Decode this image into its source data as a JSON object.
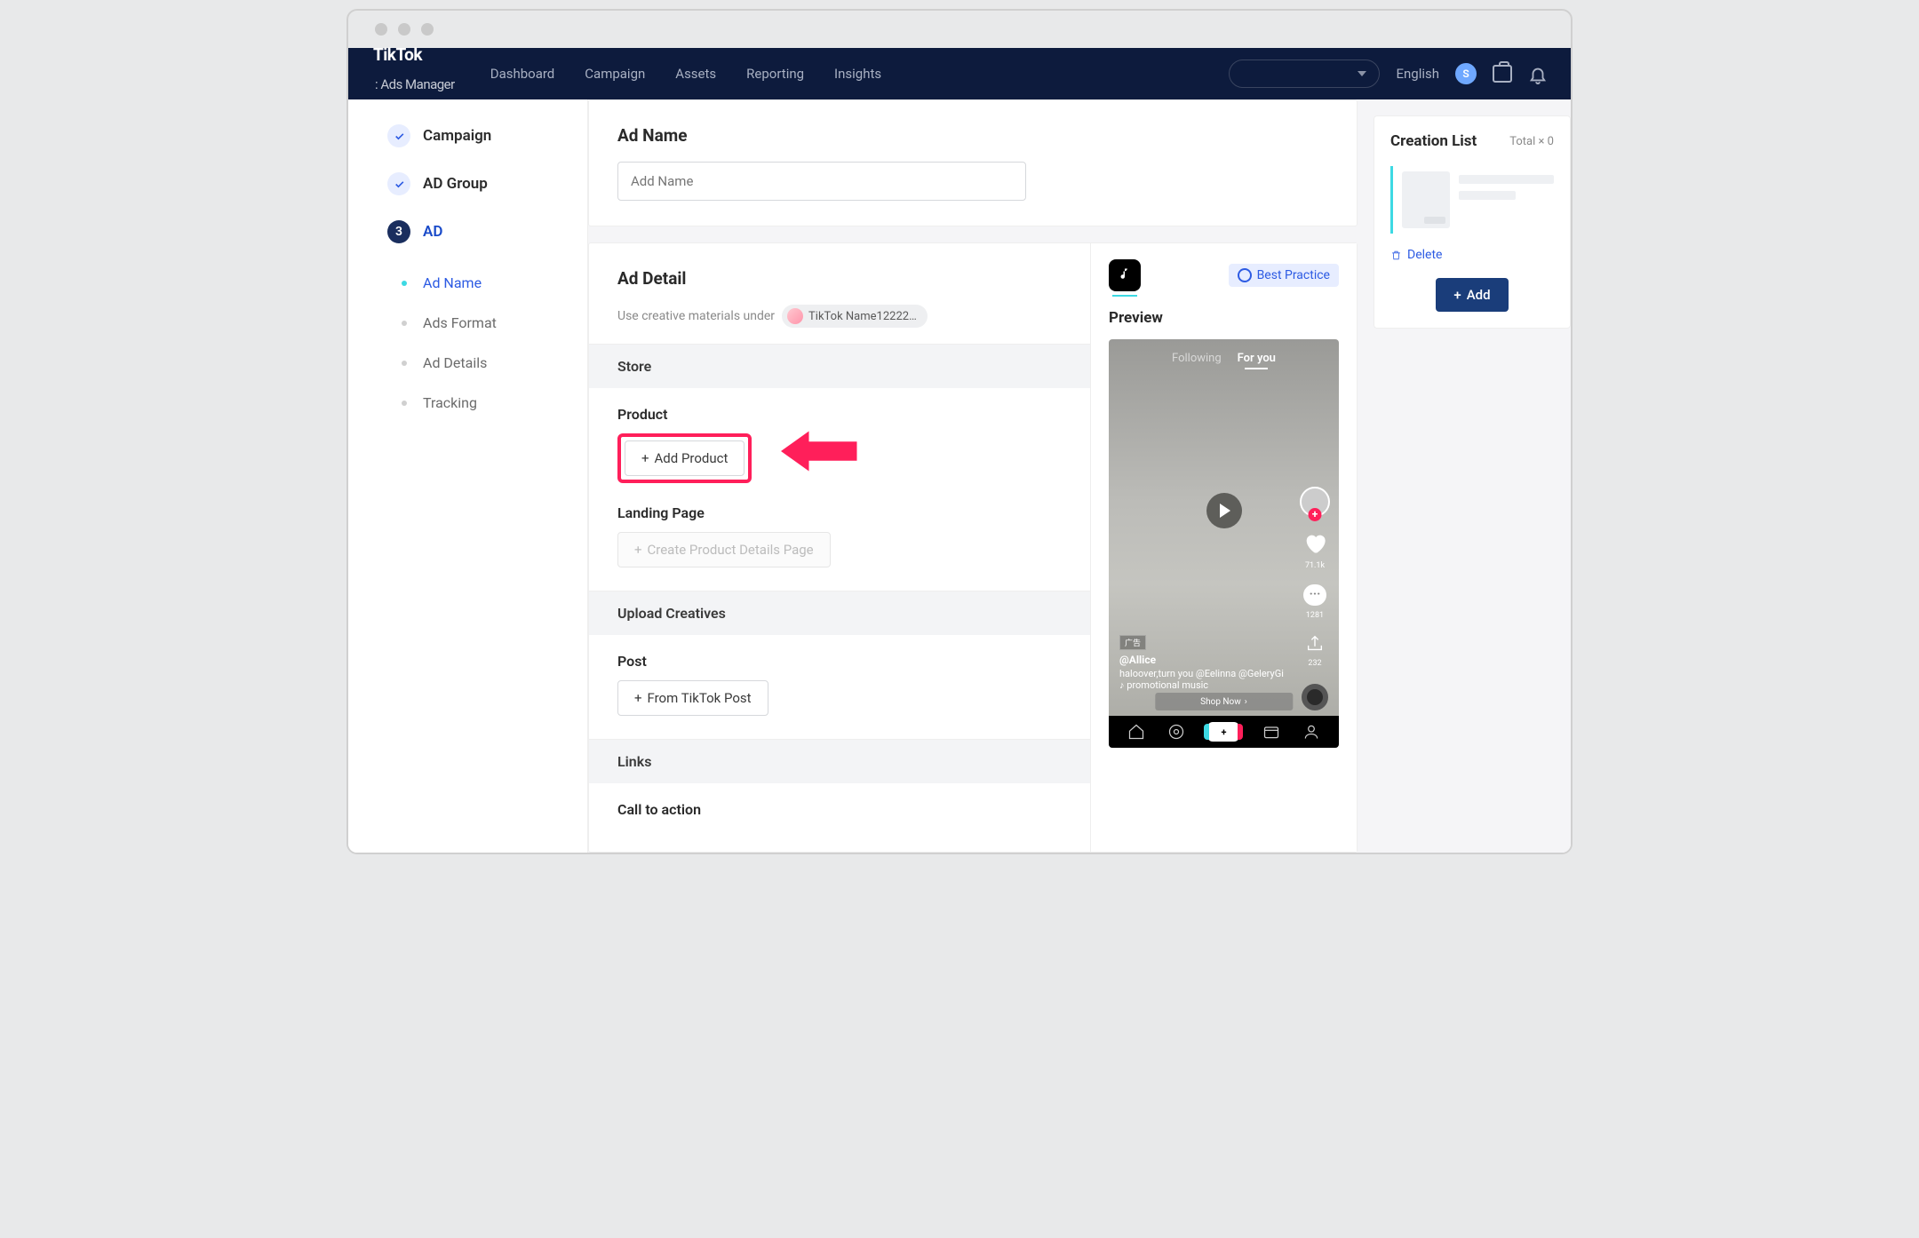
{
  "brand": {
    "name": "TikTok",
    "sub": ": Ads Manager"
  },
  "nav": {
    "items": [
      "Dashboard",
      "Campaign",
      "Assets",
      "Reporting",
      "Insights"
    ],
    "lang": "English",
    "avatar": "S"
  },
  "sidebar": {
    "steps": [
      {
        "label": "Campaign",
        "status": "done"
      },
      {
        "label": "AD Group",
        "status": "done"
      },
      {
        "label": "AD",
        "status": "active",
        "num": "3"
      }
    ],
    "subs": [
      "Ad Name",
      "Ads Format",
      "Ad Details",
      "Tracking"
    ]
  },
  "adname": {
    "title": "Ad Name",
    "placeholder": "Add Name"
  },
  "addetail": {
    "title": "Ad Detail",
    "under": "Use creative materials under",
    "account": "TikTok Name12222…",
    "store": "Store",
    "product": "Product",
    "addProduct": "Add Product",
    "landing": "Landing Page",
    "createPage": "Create Product Details Page",
    "upload": "Upload Creatives",
    "post": "Post",
    "fromPost": "From TikTok Post",
    "links": "Links",
    "cta": "Call to action"
  },
  "preview": {
    "best": "Best Practice",
    "title": "Preview",
    "tabs": {
      "following": "Following",
      "foryou": "For you"
    },
    "user": "@Allice",
    "caption": "haloover,turn you @Eelinna @GeleryGi",
    "music": "promotional music",
    "adTag": "广告",
    "likes": "71.1k",
    "comments": "1281",
    "shares": "232",
    "shop": "Shop Now"
  },
  "creation": {
    "title": "Creation List",
    "total": "Total  × 0",
    "delete": "Delete",
    "add": "Add"
  }
}
